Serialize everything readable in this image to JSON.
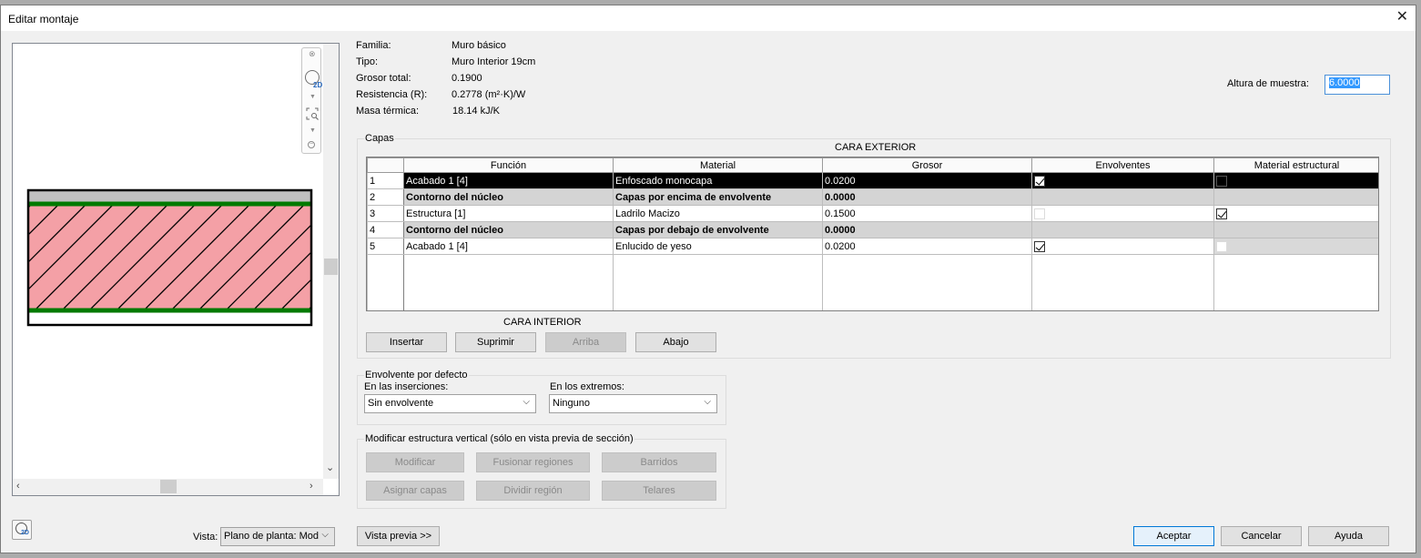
{
  "window": {
    "title": "Editar montaje",
    "close": "✕"
  },
  "info": {
    "familia_label": "Familia:",
    "familia_value": "Muro básico",
    "tipo_label": "Tipo:",
    "tipo_value": "Muro Interior 19cm",
    "grosor_label": "Grosor total:",
    "grosor_value": "0.1900",
    "resistencia_label": "Resistencia (R):",
    "resistencia_value": "0.2778 (m²·K)/W",
    "masa_label": "Masa térmica:",
    "masa_value": "18.14 kJ/K",
    "sample_label": "Altura de muestra:",
    "sample_value": "6.0000"
  },
  "layers": {
    "group_label": "Capas",
    "exterior_label": "CARA EXTERIOR",
    "interior_label": "CARA INTERIOR",
    "columns": [
      "Función",
      "Material",
      "Grosor",
      "Envolventes",
      "Material estructural"
    ],
    "rows": [
      {
        "num": "1",
        "funcion": "Acabado 1 [4]",
        "material": "Enfoscado monocapa",
        "grosor": "0.0200"
      },
      {
        "num": "2",
        "funcion": "Contorno del núcleo",
        "material": "Capas por encima de envolvente",
        "grosor": "0.0000"
      },
      {
        "num": "3",
        "funcion": "Estructura [1]",
        "material": "Ladrilo Macizo",
        "grosor": "0.1500"
      },
      {
        "num": "4",
        "funcion": "Contorno del núcleo",
        "material": "Capas por debajo de envolvente",
        "grosor": "0.0000"
      },
      {
        "num": "5",
        "funcion": "Acabado 1 [4]",
        "material": "Enlucido de yeso",
        "grosor": "0.0200"
      }
    ],
    "buttons": {
      "insert": "Insertar",
      "delete": "Suprimir",
      "up": "Arriba",
      "down": "Abajo"
    }
  },
  "wrapping": {
    "group_label": "Envolvente por defecto",
    "inserts_label": "En las inserciones:",
    "inserts_value": "Sin envolvente",
    "ends_label": "En los extremos:",
    "ends_value": "Ninguno"
  },
  "vertical": {
    "group_label": "Modificar estructura vertical (sólo en vista previa de sección)",
    "modify": "Modificar",
    "merge": "Fusionar regiones",
    "sweeps": "Barridos",
    "assign": "Asignar capas",
    "split": "Dividir región",
    "reveals": "Telares"
  },
  "footer": {
    "view_label": "Vista:",
    "view_value": "Plano de planta: Mod",
    "preview_button": "Vista previa >>",
    "ok": "Aceptar",
    "cancel": "Cancelar",
    "help": "Ayuda"
  },
  "nav": {
    "label_2d": "2D"
  },
  "colors": {
    "accent": "#0078d7",
    "selected_row": "#000000",
    "core_boundary_row": "#d4d4d4",
    "wall_fill": "#f4a0a6",
    "wall_finish": "#c0c0c0",
    "core_line": "#007a00"
  }
}
